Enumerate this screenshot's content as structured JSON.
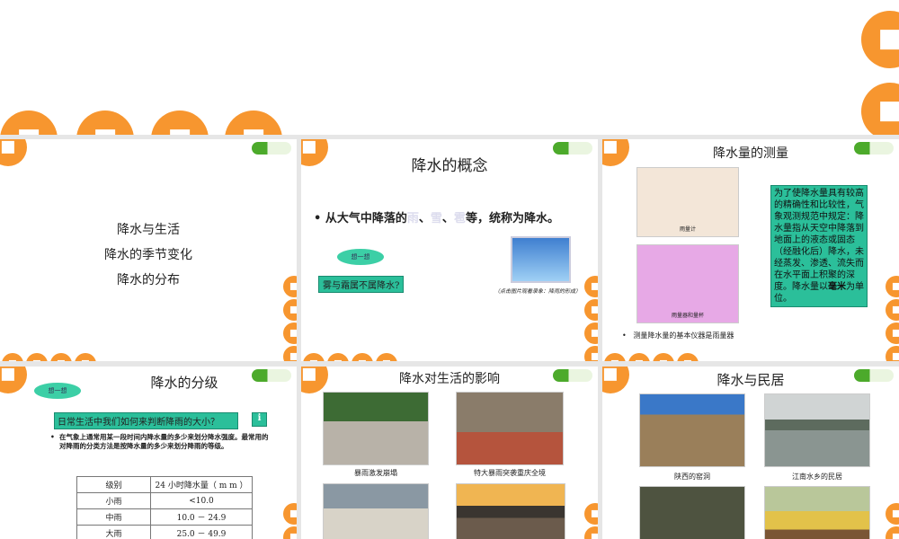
{
  "slides": [
    {
      "lines": [
        "降水与生活",
        "降水的季节变化",
        "降水的分布"
      ]
    },
    {
      "title": "降水的概念",
      "bullet_pre": "从大气中降落的",
      "w1": "雨",
      "w2": "雪",
      "w3": "雹",
      "bullet_post": "等，统称为降水。",
      "sep": "、",
      "think": "想一想",
      "question": "雾与霜属不属降水?",
      "video_caption": "（点击图片观看录象：降雨的形成）"
    },
    {
      "title": "降水量的测量",
      "img1_caption": "雨量计",
      "img2_caption": "雨量器和量杯",
      "definition": "为了使降水量具有较高的精确性和比较性，气象观测规范中规定：降水量指从天空中降落到地面上的液态或固态（经融化后）降水，未经蒸发、渗透、流失而在水平面上积聚的深度。降水量以",
      "unit_bold": "毫米",
      "definition_end": "为单位。",
      "bullet": "测量降水量的基本仪器是雨量器"
    },
    {
      "title": "降水的分级",
      "think": "想一想",
      "question": "日常生活中我们如何来判断降雨的大小？",
      "info": "i",
      "bullet": "在气象上通常用某一段时间内降水量的多少来划分降水强度。最常用的对降雨的分类方法是按降水量的多少来划分降雨的等级。",
      "table": {
        "headers": [
          "级别",
          "24 小时降水量（ m m ）"
        ],
        "rows": [
          [
            "小雨",
            "<10.0"
          ],
          [
            "中雨",
            "10.0 － 24.9"
          ],
          [
            "大雨",
            "25.0 － 49.9"
          ]
        ]
      }
    },
    {
      "title": "降水对生活的影响",
      "captions": [
        "暴雨激发崩塌",
        "特大暴雨突袭重庆全境"
      ]
    },
    {
      "title": "降水与民居",
      "captions": [
        "陕西的窑洞",
        "江南水乡的民居"
      ]
    }
  ],
  "colors": {
    "orange": "#f7962f",
    "teal": "#2bbf9a"
  }
}
